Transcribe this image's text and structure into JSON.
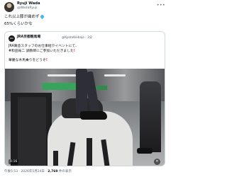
{
  "tweet": {
    "author_name": "Ryuji Wada",
    "author_handle": "@WadaRyuji",
    "more_icon": "more-horizontal-icon",
    "text_line1": "これ以上膝が曲めず",
    "text_line2": "65%くらいかな",
    "emoji": "droplet-icon"
  },
  "quoted": {
    "author_name": "JRA京都競馬場",
    "author_handle": "@KyotoKeibajo · 3分",
    "line1": "JRA厩舎スタッフのお仕事紹介イベントにて、",
    "line2": "#和田竜二 調教師にご参加いただきました",
    "line3": "華麗な木馬乗りをどうぞ",
    "video_time": "0:16",
    "mute_icon": "speaker-muted-icon"
  },
  "meta": {
    "timestamp": "午後5:53 · 2026年5月24日",
    "views_count": "2,769",
    "views_label": "件の表示"
  },
  "colors": {
    "text": "#0f1419",
    "secondary": "#536471",
    "border": "#cfd9de",
    "accent_red": "#e0245e",
    "emoji_blue": "#4fb3e8"
  }
}
